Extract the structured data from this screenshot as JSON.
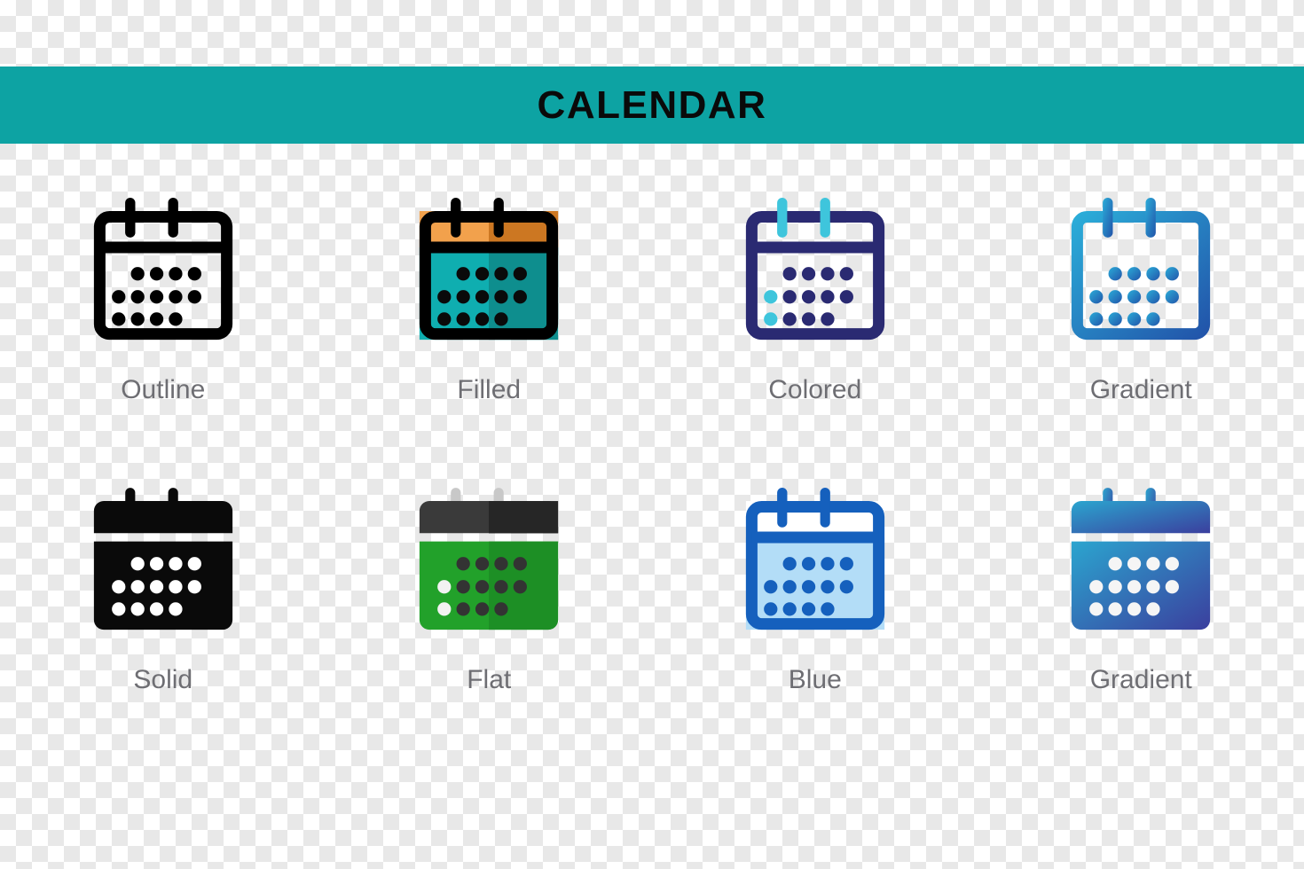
{
  "banner": {
    "title": "CALENDAR",
    "background_color": "#0da3a3",
    "text_color": "#0a0a0a"
  },
  "page": {
    "background": "transparent-checkerboard",
    "checker_light": "#ffffff",
    "checker_dark": "#e8e8e8",
    "label_color": "#6e6e73"
  },
  "icon": {
    "name": "calendar-icon",
    "dot_rows": [
      [
        2,
        3,
        4,
        5
      ],
      [
        1,
        2,
        3,
        4,
        5
      ],
      [
        1,
        2,
        3,
        4
      ]
    ]
  },
  "icons": [
    {
      "label": "Outline",
      "id": "outline",
      "variant": "outline",
      "stroke": "#000000",
      "body_fill": "none",
      "header_fill": "none",
      "dot_color": "#000000",
      "ring_color": "#000000",
      "accent_dots": [],
      "accent_color": ""
    },
    {
      "label": "Filled",
      "id": "filled",
      "variant": "outline-filled",
      "stroke": "#000000",
      "header_fill": "#f2a14c",
      "header_fill_dark": "#cc7722",
      "body_fill": "#0faeb0",
      "body_fill_dark": "#0e8e8e",
      "dot_color": "#0a0a0a",
      "ring_color": "#000000",
      "accent_dots": [],
      "accent_color": ""
    },
    {
      "label": "Colored",
      "id": "colored",
      "variant": "outline",
      "stroke": "#2a2a72",
      "body_fill": "none",
      "header_fill": "none",
      "dot_color": "#2a2a72",
      "ring_color": "#3ec5dc",
      "accent_dots": [
        "r2c1",
        "r3c1"
      ],
      "accent_color": "#3ec5dc"
    },
    {
      "label": "Gradient",
      "id": "gradient-outline",
      "variant": "outline",
      "stroke": "gradient",
      "gradient_from": "#2bacd8",
      "gradient_to": "#2255aa",
      "body_fill": "none",
      "header_fill": "none",
      "dot_color": "gradient",
      "ring_color": "gradient",
      "accent_dots": [],
      "accent_color": ""
    },
    {
      "label": "Solid",
      "id": "solid",
      "variant": "solid",
      "header_fill": "#0a0a0a",
      "body_fill": "#0a0a0a",
      "dot_color": "#ffffff",
      "ring_color": "#0a0a0a",
      "accent_dots": [],
      "accent_color": ""
    },
    {
      "label": "Flat",
      "id": "flat",
      "variant": "solid",
      "header_fill": "#3a3a3a",
      "header_fill_dark": "#262626",
      "body_fill": "#22a12a",
      "body_fill_dark": "#1d8f25",
      "dot_color": "#333333",
      "ring_color": "#c8c8c8",
      "accent_dots": [
        "r2c1",
        "r3c1"
      ],
      "accent_color": "#f2f2f2"
    },
    {
      "label": "Blue",
      "id": "blue",
      "variant": "outline-filled",
      "stroke": "#1560bd",
      "header_fill": "#ffffff",
      "body_fill": "#b3ddf7",
      "dot_color": "#1560bd",
      "ring_color": "#1560bd",
      "accent_dots": [],
      "accent_color": ""
    },
    {
      "label": "Gradient",
      "id": "gradient-solid",
      "variant": "solid",
      "header_fill": "gradient",
      "body_fill": "gradient",
      "gradient_from": "#2ba5cf",
      "gradient_to": "#3b3f9e",
      "dot_color": "#f5f5f5",
      "ring_color": "gradient",
      "accent_dots": [],
      "accent_color": ""
    }
  ]
}
